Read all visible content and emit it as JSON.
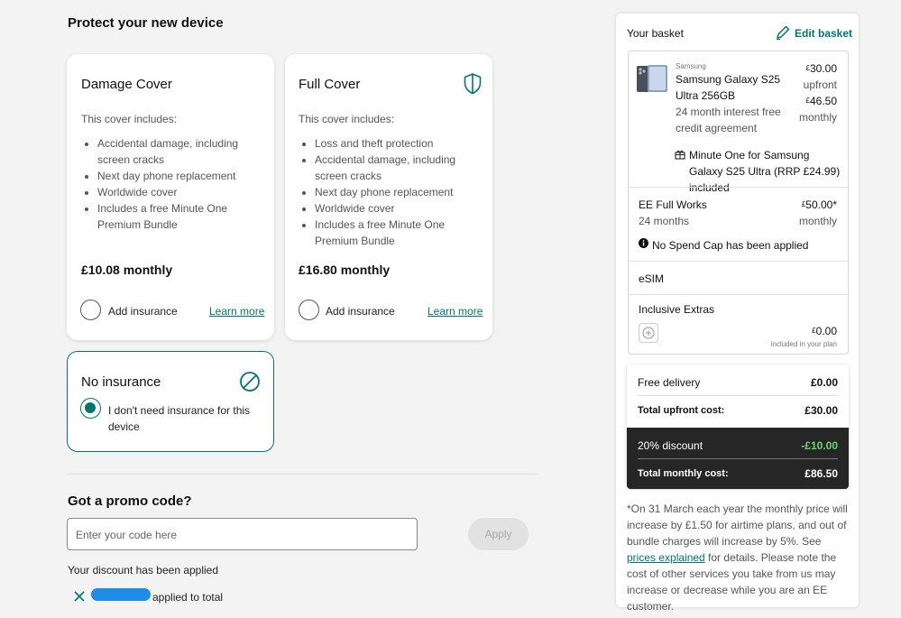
{
  "protect": {
    "title": "Protect your new device",
    "damage": {
      "title": "Damage Cover",
      "subtitle": "This cover includes:",
      "features": [
        "Accidental damage, including screen cracks",
        "Next day phone replacement",
        "Worldwide cover",
        "Includes a free Minute One Premium Bundle"
      ],
      "price": "£10.08 monthly",
      "add_label": "Add insurance",
      "learn_label": "Learn more"
    },
    "full": {
      "title": "Full Cover",
      "subtitle": "This cover includes:",
      "features": [
        "Loss and theft protection",
        "Accidental damage, including screen cracks",
        "Next day phone replacement",
        "Worldwide cover",
        "Includes a free Minute One Premium Bundle"
      ],
      "price": "£16.80 monthly",
      "add_label": "Add insurance",
      "learn_label": "Learn more"
    },
    "none": {
      "title": "No insurance",
      "option_label": "I don't need insurance for this device",
      "selected": true
    }
  },
  "promo": {
    "title": "Got a promo code?",
    "placeholder": "Enter your code here",
    "apply_label": "Apply",
    "discount_msg": "Your discount has been applied",
    "applied_suffix": "applied to total"
  },
  "basket": {
    "title": "Your basket",
    "edit_label": "Edit basket",
    "device": {
      "brand": "Samsung",
      "name": "Samsung Galaxy S25 Ultra 256GB",
      "agreement": "24 month interest free credit agreement",
      "upfront_price": "30.00",
      "upfront_label": "upfront",
      "monthly_price": "46.50",
      "monthly_label": "monthly",
      "gift": "Minute One for Samsung Galaxy S25 Ultra (RRP £24.99) included"
    },
    "plan": {
      "name": "EE Full Works",
      "term": "24 months",
      "price": "50.00*",
      "price_label": "monthly",
      "note": "No Spend Cap has been applied"
    },
    "esim": "eSIM",
    "extras": {
      "title": "Inclusive Extras",
      "price": "0.00",
      "note": "included in your plan"
    },
    "summary": {
      "delivery_label": "Free delivery",
      "delivery_value": "£0.00",
      "upfront_label": "Total upfront cost:",
      "upfront_value": "£30.00",
      "discount_label": "20% discount",
      "discount_value": "-£10.00",
      "monthly_label": "Total monthly cost:",
      "monthly_value": "£86.50"
    },
    "footnote_a": "*On 31 March each year the monthly price will increase by £1.50 for airtime plans, and out of bundle charges will increase by 5%. See ",
    "footnote_link": "prices explained",
    "footnote_b": " for details. Please note the cost of other services you take from us may increase or decrease while you are an EE customer."
  },
  "colors": {
    "accent": "#00766f",
    "discount_green": "#6fd36f",
    "dark_panel": "#262626"
  }
}
